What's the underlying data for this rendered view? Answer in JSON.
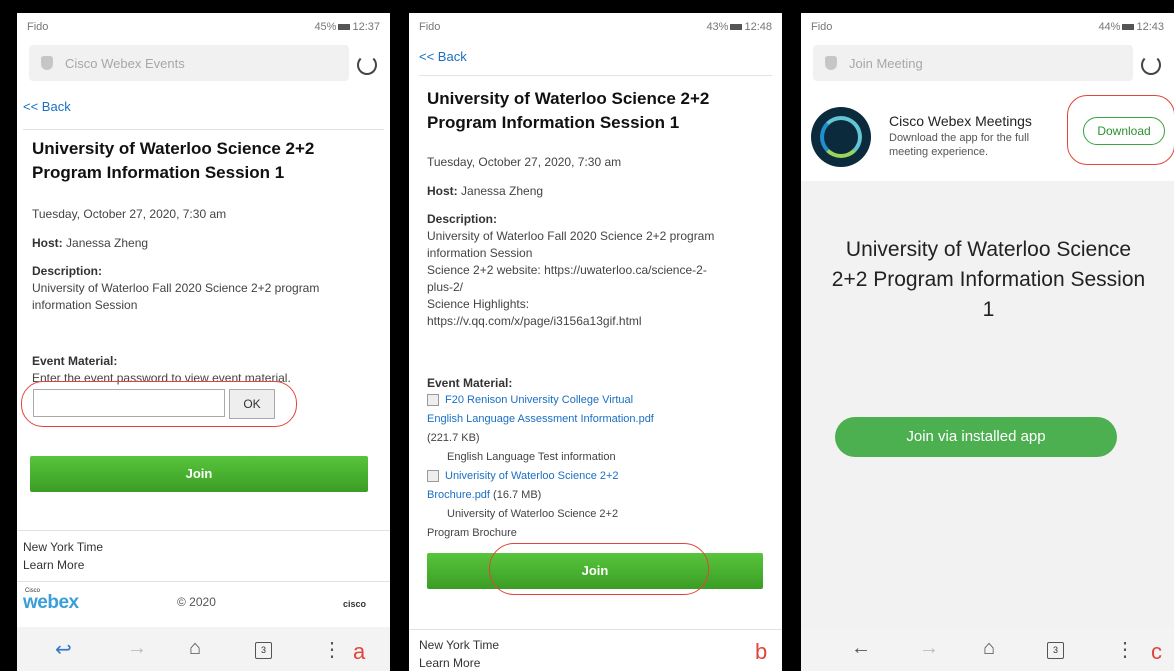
{
  "event": {
    "title": "University of Waterloo Science 2+2 Program Information Session 1",
    "date": "Tuesday, October 27, 2020, 7:30 am",
    "host_label": "Host:",
    "host_name": "Janessa Zheng",
    "description_label": "Description:",
    "description_a": "University of Waterloo Fall 2020 Science 2+2 program information Session",
    "description_b": [
      "University of Waterloo Fall 2020 Science 2+2 program",
      "information Session",
      "Science 2+2 website: https://uwaterloo.ca/science-2-",
      "plus-2/",
      "Science Highlights:",
      "https://v.qq.com/x/page/i3156a13gif.html"
    ],
    "material_label": "Event Material:",
    "password_prompt": "Enter the event password to view event material.",
    "ok_label": "OK",
    "join_label": "Join",
    "back_label": "<< Back",
    "timezone": "New York Time",
    "learn_more": "Learn More",
    "copyright": "© 2020"
  },
  "attachments": [
    {
      "link_line1": "F20 Renison University College Virtual",
      "link_line2": "English Language Assessment Information.pdf",
      "size": "(221.7 KB)",
      "note": "English Language Test information"
    },
    {
      "link_line1": "Univerisity of Waterloo Science 2+2",
      "link_line2": "Brochure.pdf",
      "size": " (16.7 MB)",
      "note_line1": "University of Waterloo Science 2+2",
      "note_line2": "Program Brochure"
    }
  ],
  "phone_a": {
    "carrier": "Fido",
    "status": "45%",
    "time": "12:37",
    "address": "Cisco Webex Events",
    "tabs": "3",
    "label": "a"
  },
  "phone_b": {
    "carrier": "Fido",
    "status": "43%",
    "time": "12:48",
    "label": "b"
  },
  "phone_c": {
    "carrier": "Fido",
    "status": "44%",
    "time": "12:43",
    "address": "Join Meeting",
    "tabs": "3",
    "label": "c",
    "app_name": "Cisco Webex Meetings",
    "app_desc": "Download the app for the full meeting experience.",
    "download_label": "Download",
    "meeting_title": "University of Waterloo Science 2+2 Program Information Session 1",
    "join_app_label": "Join via installed app"
  },
  "brand": {
    "webex_small": "Cisco",
    "webex": "webex",
    "cisco": "cisco"
  },
  "icons": {
    "back": "back-arrow-icon",
    "forward": "forward-arrow-icon",
    "home": "home-icon",
    "menu": "more-vert-icon"
  },
  "colors": {
    "join_green": "#4caf50",
    "link_blue": "#1a6fc3",
    "annotation_red": "#e0463a"
  }
}
